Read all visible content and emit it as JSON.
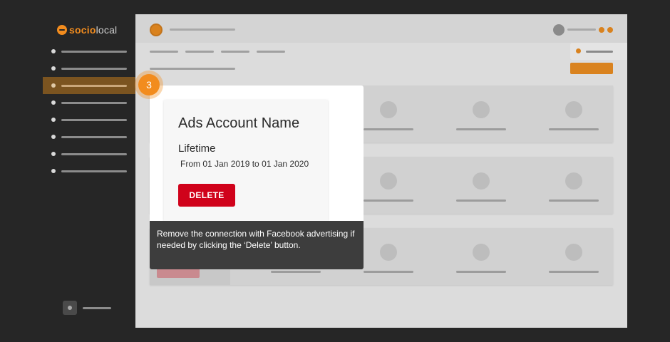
{
  "brand": {
    "name_part1": "socio",
    "name_part2": "local",
    "accent": "#f28c1e"
  },
  "sidebar": {
    "items": [
      {
        "active": false
      },
      {
        "active": false
      },
      {
        "active": true
      },
      {
        "active": false
      },
      {
        "active": false
      },
      {
        "active": false
      },
      {
        "active": false
      },
      {
        "active": false
      }
    ]
  },
  "tour": {
    "step_number": "3"
  },
  "ad_account": {
    "name": "Ads Account Name",
    "period_label": "Lifetime",
    "date_range": "From 01 Jan 2019  to 01 Jan 2020",
    "delete_label": "DELETE"
  },
  "tooltip": {
    "text": "Remove the connection with Facebook advertising if needed by clicking the ‘Delete’ button."
  },
  "colors": {
    "delete_button": "#d0021b",
    "sidebar_bg": "#262626",
    "tooltip_bg": "#3d3d3d"
  }
}
